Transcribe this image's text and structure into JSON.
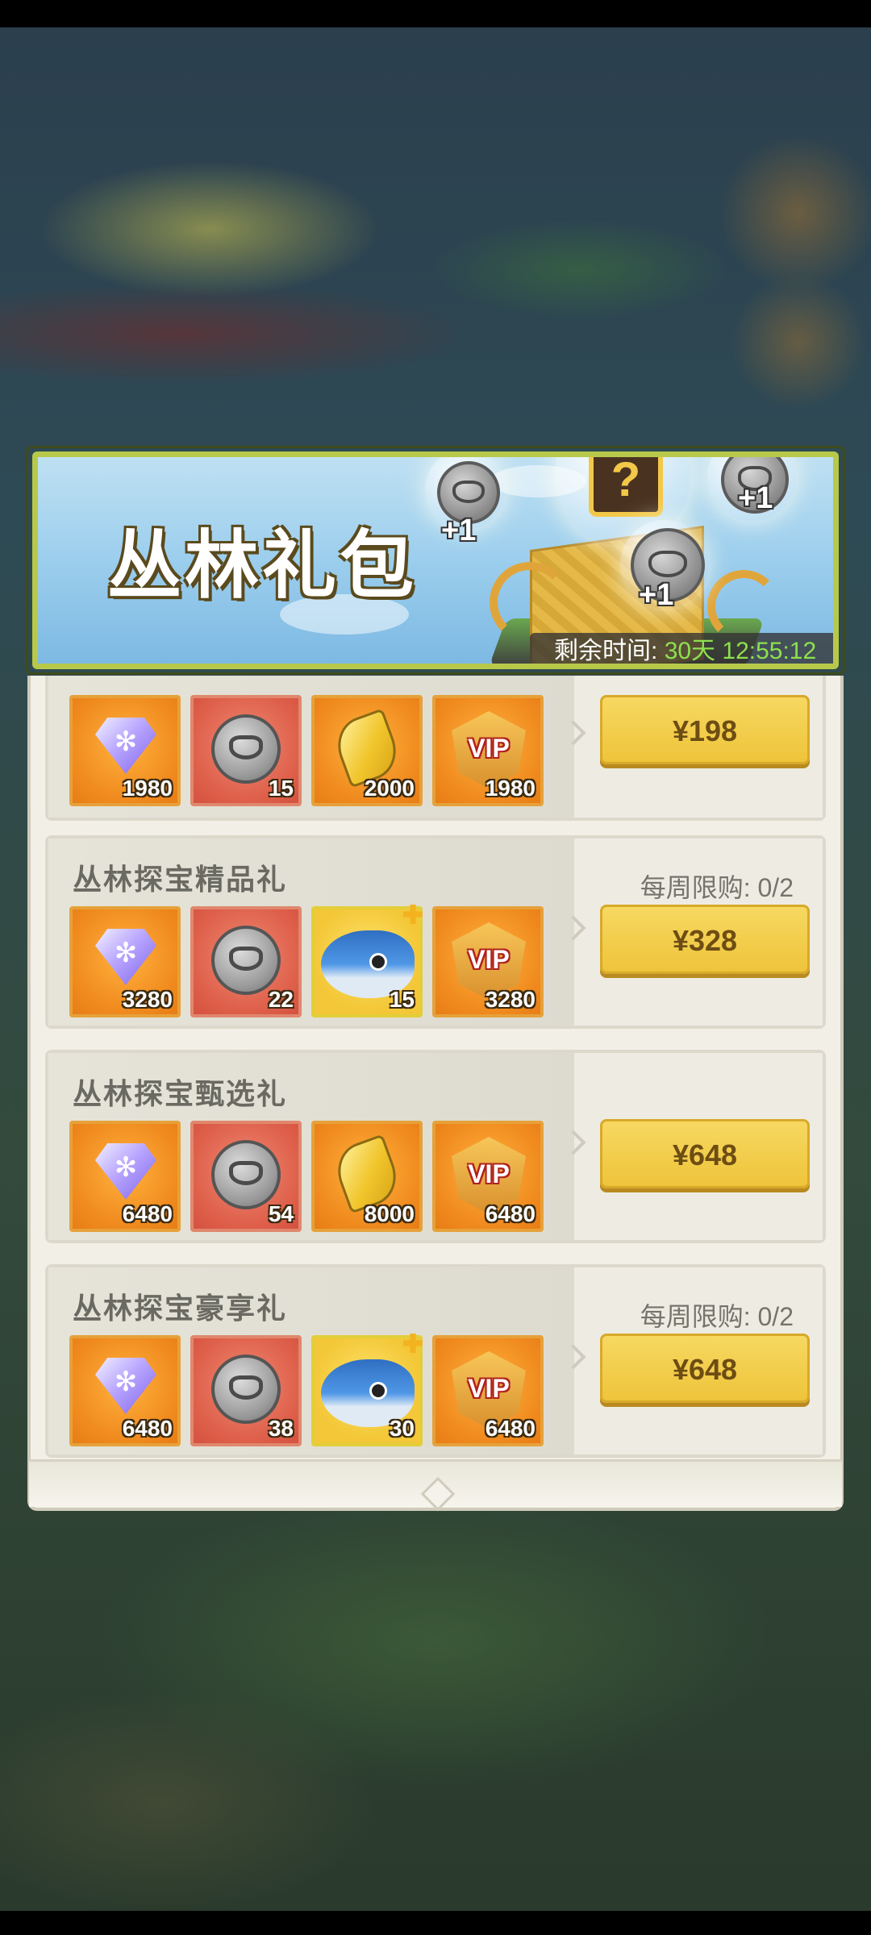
{
  "banner": {
    "title": "丛林礼包",
    "timer_label": "剩余时间:",
    "timer_value": "30天 12:55:12",
    "plus_labels": [
      "+1",
      "+1",
      "+1"
    ],
    "mystery_symbol": "?"
  },
  "packs": [
    {
      "title": "",
      "limit": "",
      "price": "¥198",
      "items": [
        {
          "icon": "gem-icon",
          "count": "1980"
        },
        {
          "icon": "coin-icon",
          "count": "15"
        },
        {
          "icon": "leaf-icon",
          "count": "2000"
        },
        {
          "icon": "vip-icon",
          "count": "1980"
        }
      ]
    },
    {
      "title": "丛林探宝精品礼",
      "limit": "每周限购: 0/2",
      "price": "¥328",
      "items": [
        {
          "icon": "gem-icon",
          "count": "3280"
        },
        {
          "icon": "coin-icon",
          "count": "22"
        },
        {
          "icon": "fish-pet-icon",
          "count": "15"
        },
        {
          "icon": "vip-icon",
          "count": "3280"
        }
      ]
    },
    {
      "title": "丛林探宝甄选礼",
      "limit": "",
      "price": "¥648",
      "items": [
        {
          "icon": "gem-icon",
          "count": "6480"
        },
        {
          "icon": "coin-icon",
          "count": "54"
        },
        {
          "icon": "leaf-icon",
          "count": "8000"
        },
        {
          "icon": "vip-icon",
          "count": "6480"
        }
      ]
    },
    {
      "title": "丛林探宝豪享礼",
      "limit": "每周限购: 0/2",
      "price": "¥648",
      "items": [
        {
          "icon": "gem-icon",
          "count": "6480"
        },
        {
          "icon": "coin-icon",
          "count": "38"
        },
        {
          "icon": "fish-pet-icon",
          "count": "30"
        },
        {
          "icon": "vip-icon",
          "count": "6480"
        }
      ]
    }
  ],
  "vip_text": "VIP",
  "colors": {
    "button": "#f3cf4c",
    "timer_value": "#8de04e",
    "banner_frame": "#b8c94a"
  }
}
